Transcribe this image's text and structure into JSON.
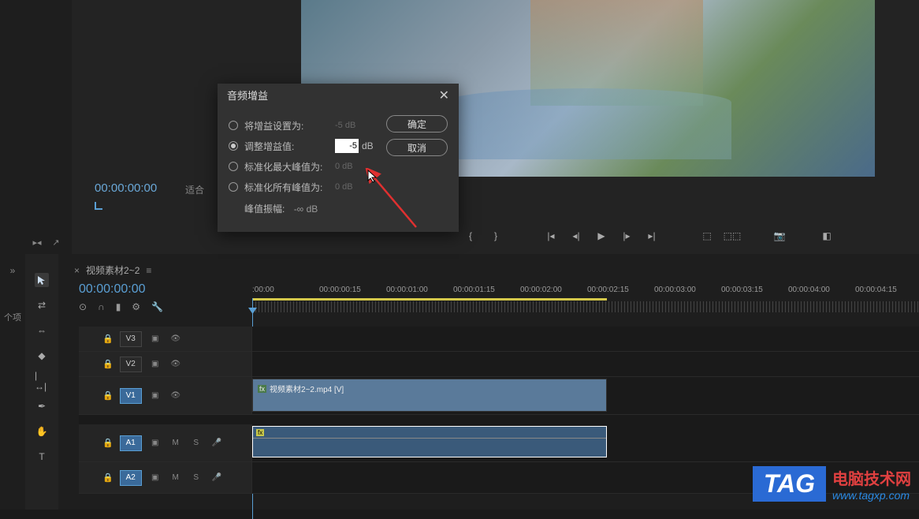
{
  "source": {
    "timecode": "00:00:00:00",
    "fit_label": "适合"
  },
  "dialog": {
    "title": "音频增益",
    "options": {
      "set_gain": {
        "label": "将增益设置为:",
        "value": "-5 dB"
      },
      "adjust_gain": {
        "label": "调整增益值:",
        "value": "-5",
        "suffix": "dB"
      },
      "norm_max": {
        "label": "标准化最大峰值为:",
        "value": "0 dB"
      },
      "norm_all": {
        "label": "标准化所有峰值为:",
        "value": "0 dB"
      }
    },
    "peak": {
      "label": "峰值振幅:",
      "value": "-∞ dB"
    },
    "ok": "确定",
    "cancel": "取消"
  },
  "sequence": {
    "tab_name": "视频素材2~2",
    "playhead": "00:00:00:00"
  },
  "ruler": {
    "labels": [
      ":00:00",
      "00:00:00:15",
      "00:00:01:00",
      "00:00:01:15",
      "00:00:02:00",
      "00:00:02:15",
      "00:00:03:00",
      "00:00:03:15",
      "00:00:04:00",
      "00:00:04:15"
    ]
  },
  "tracks": {
    "v3": "V3",
    "v2": "V2",
    "v1": "V1",
    "a1": "A1",
    "a2": "A2"
  },
  "clips": {
    "video_label": "视频素材2~2.mp4 [V]"
  },
  "sidebar_label": "个项",
  "watermark": {
    "tag": "TAG",
    "cn": "电脑技术网",
    "url": "www.tagxp.com"
  }
}
